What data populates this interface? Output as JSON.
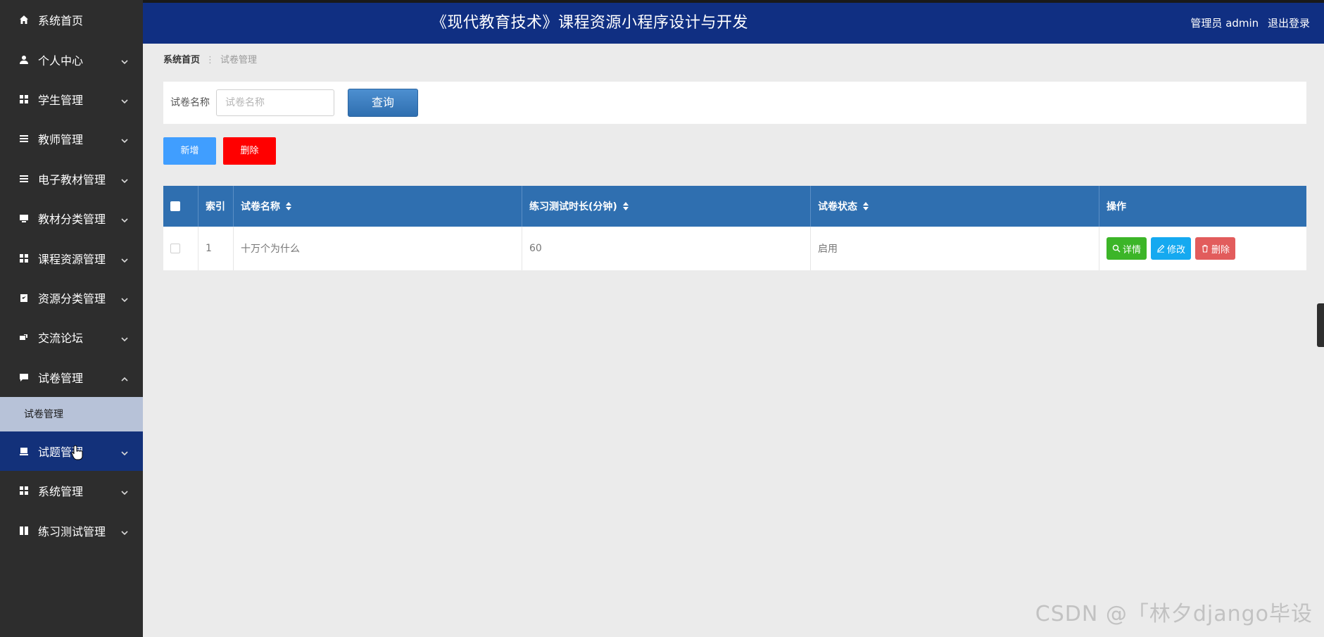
{
  "header": {
    "title": "《现代教育技术》课程资源小程序设计与开发",
    "user_label": "管理员 admin",
    "logout_label": "退出登录"
  },
  "sidebar": {
    "items": [
      {
        "label": "系统首页",
        "icon": "home-icon"
      },
      {
        "label": "个人中心",
        "icon": "user-icon"
      },
      {
        "label": "学生管理",
        "icon": "grid-icon"
      },
      {
        "label": "教师管理",
        "icon": "list-icon"
      },
      {
        "label": "电子教材管理",
        "icon": "list-icon"
      },
      {
        "label": "教材分类管理",
        "icon": "monitor-icon"
      },
      {
        "label": "课程资源管理",
        "icon": "grid-icon"
      },
      {
        "label": "资源分类管理",
        "icon": "clipboard-icon"
      },
      {
        "label": "交流论坛",
        "icon": "chat-icon"
      },
      {
        "label": "试卷管理",
        "icon": "message-icon"
      },
      {
        "label": "试题管理",
        "icon": "tray-icon"
      },
      {
        "label": "系统管理",
        "icon": "grid-icon"
      },
      {
        "label": "练习测试管理",
        "icon": "book-icon"
      }
    ],
    "sub_item": "试卷管理"
  },
  "breadcrumb": {
    "home": "系统首页",
    "current": "试卷管理"
  },
  "search": {
    "label": "试卷名称",
    "placeholder": "试卷名称",
    "button": "查询"
  },
  "actions": {
    "add": "新增",
    "delete": "删除"
  },
  "table": {
    "columns": [
      "索引",
      "试卷名称",
      "练习测试时长(分钟)",
      "试卷状态",
      "操作"
    ],
    "rows": [
      {
        "index": "1",
        "name": "十万个为什么",
        "duration": "60",
        "status": "启用"
      }
    ],
    "row_actions": {
      "detail": "详情",
      "edit": "修改",
      "delete": "删除"
    }
  },
  "watermark": "CSDN @「林夕django毕设"
}
